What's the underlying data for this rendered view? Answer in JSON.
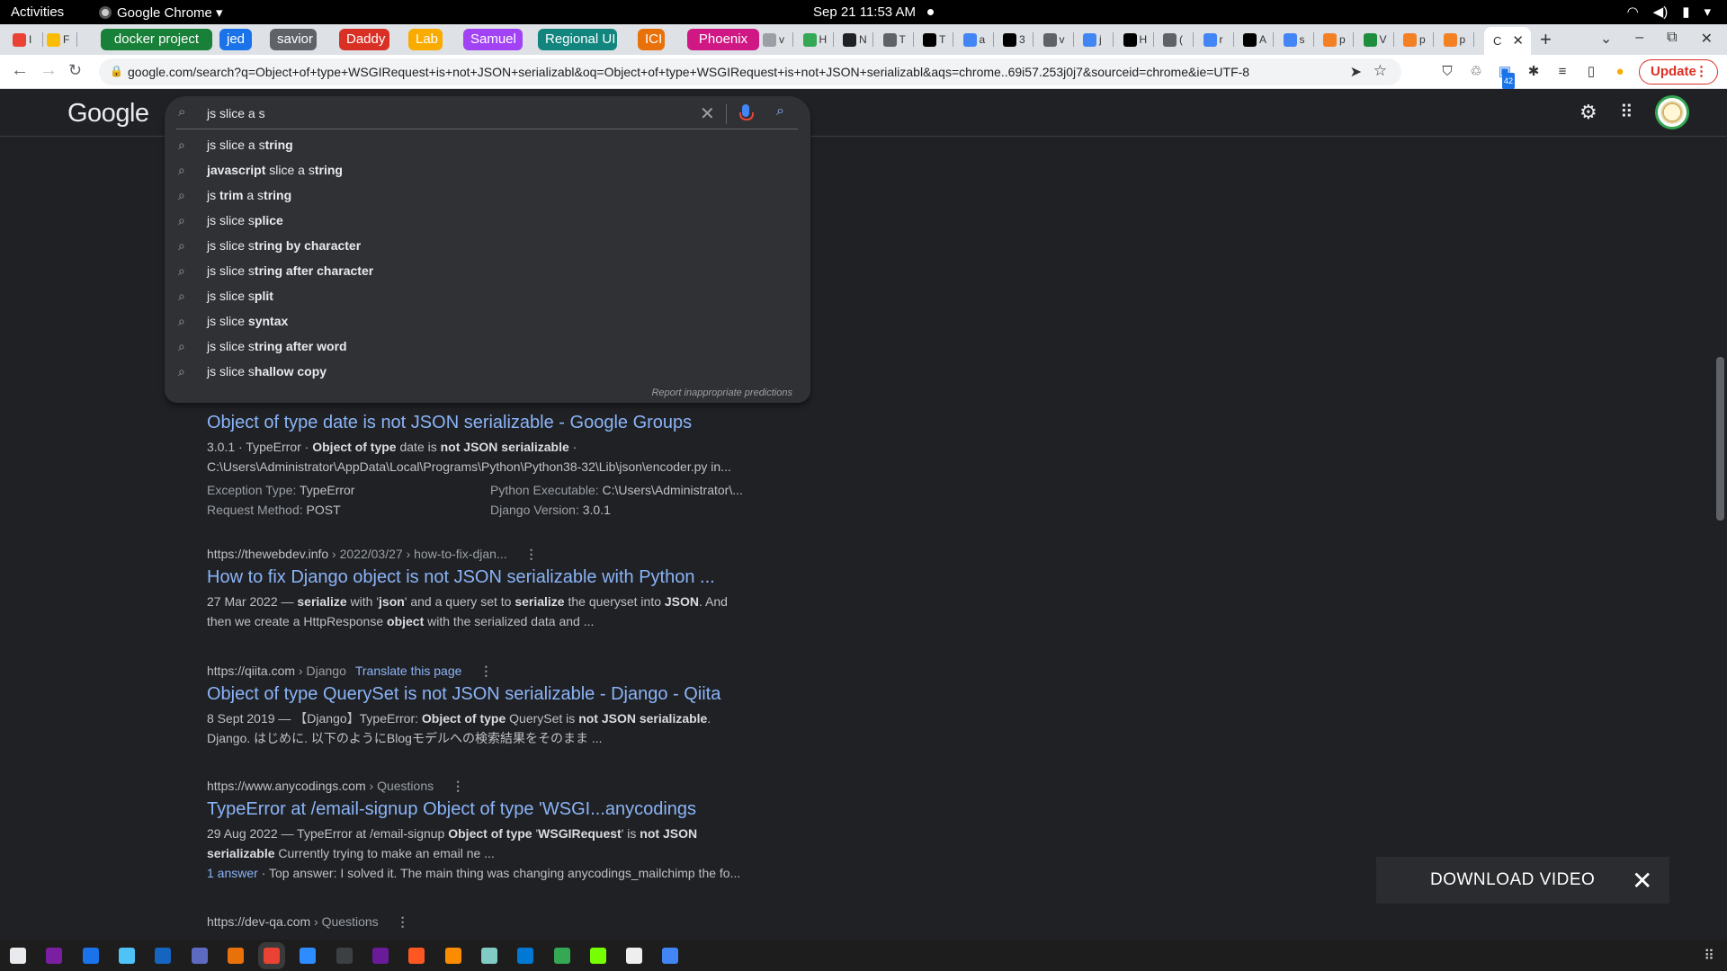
{
  "topbar": {
    "activities": "Activities",
    "app_name": "Google Chrome ▾",
    "clock": "Sep 21  11:53 AM"
  },
  "tabs": {
    "group_tabs": [
      {
        "label": "docker project",
        "color": "#188038"
      },
      {
        "label": "jed",
        "color": "#1a73e8"
      },
      {
        "label": "savior",
        "color": "#5f6368"
      },
      {
        "label": "Daddy",
        "color": "#d93025"
      },
      {
        "label": "Lab",
        "color": "#f9ab00"
      },
      {
        "label": "Samuel",
        "color": "#a142f4"
      },
      {
        "label": "Regional UI",
        "color": "#12857e"
      },
      {
        "label": "ICI",
        "color": "#e8710a"
      },
      {
        "label": "Phoenix",
        "color": "#d01884"
      }
    ],
    "pinned_left": [
      {
        "letter": "I",
        "icon": "gmail-icon",
        "color": "#ea4335"
      },
      {
        "letter": "F",
        "icon": "drive-icon",
        "color": "#fbbc04"
      }
    ],
    "small_tabs": [
      {
        "letter": "v",
        "icon": "google-icon",
        "color": "#9aa0a6"
      },
      {
        "letter": "H",
        "icon": "extension-icon",
        "color": "#34a853"
      },
      {
        "letter": "N",
        "icon": "code-icon",
        "color": "#202124"
      },
      {
        "letter": "T",
        "icon": "globe-icon",
        "color": "#5f6368"
      },
      {
        "letter": "T",
        "icon": "medium-icon",
        "color": "#000000"
      },
      {
        "letter": "a",
        "icon": "google-icon",
        "color": "#4285f4"
      },
      {
        "letter": "3",
        "icon": "medium-icon",
        "color": "#000000"
      },
      {
        "letter": "v",
        "icon": "globe-icon",
        "color": "#5f6368"
      },
      {
        "letter": "j",
        "icon": "google-icon",
        "color": "#4285f4"
      },
      {
        "letter": "H",
        "icon": "m-icon",
        "color": "#000000"
      },
      {
        "letter": "(",
        "icon": "audio-icon",
        "color": "#5f6368"
      },
      {
        "letter": "r",
        "icon": "google-icon",
        "color": "#4285f4"
      },
      {
        "letter": "A",
        "icon": "github-icon",
        "color": "#000000"
      },
      {
        "letter": "s",
        "icon": "google-icon",
        "color": "#4285f4"
      },
      {
        "letter": "p",
        "icon": "stackoverflow-icon",
        "color": "#f48024"
      },
      {
        "letter": "V",
        "icon": "app-icon",
        "color": "#1e8e3e"
      },
      {
        "letter": "p",
        "icon": "stackoverflow-icon",
        "color": "#f48024"
      },
      {
        "letter": "p",
        "icon": "stackoverflow-icon",
        "color": "#f48024"
      }
    ],
    "active_tab": {
      "letter": "C"
    }
  },
  "toolbar": {
    "url": "google.com/search?q=Object+of+type+WSGIRequest+is+not+JSON+serializabl&oq=Object+of+type+WSGIRequest+is+not+JSON+serializabl&aqs=chrome..69i57.253j0j7&sourceid=chrome&ie=UTF-8",
    "update_label": "Update",
    "badge": "42"
  },
  "google": {
    "logo": "Google",
    "query": "js slice a s",
    "suggestions": [
      {
        "plain": "js slice a s",
        "bold": "tring"
      },
      {
        "bold_pre": "javascript",
        "plain": " slice a s",
        "bold": "tring"
      },
      {
        "plain": "js ",
        "bold_mid": "trim",
        "plain2": " a s",
        "bold": "tring"
      },
      {
        "plain": "js slice s",
        "bold": "plice"
      },
      {
        "plain": "js slice s",
        "bold": "tring by character"
      },
      {
        "plain": "js slice s",
        "bold": "tring after character"
      },
      {
        "plain": "js slice s",
        "bold": "plit"
      },
      {
        "plain": "js slice ",
        "bold": "syntax"
      },
      {
        "plain": "js slice s",
        "bold": "tring after word"
      },
      {
        "plain": "js slice s",
        "bold": "hallow copy"
      }
    ],
    "report": "Report inappropriate predictions"
  },
  "results": [
    {
      "title": "Object of type date is not JSON serializable - Google Groups",
      "snippet_html": "3.0.1 · TypeError · <b>Object of type</b> date is <b>not JSON serializable</b> ·<br>C:\\Users\\Administrator\\AppData\\Local\\Programs\\Python\\Python38-32\\Lib\\json\\encoder.py in...",
      "rich": [
        [
          "Exception Type:",
          "TypeError",
          "Python Executable:",
          "C:\\Users\\Administrator\\..."
        ],
        [
          "Request Method:",
          "POST",
          "Django Version:",
          "3.0.1"
        ]
      ]
    },
    {
      "cite": "https://thewebdev.info",
      "path": " › 2022/03/27 › how-to-fix-djan...",
      "title": "How to fix Django object is not JSON serializable with Python ...",
      "snippet_html": "27 Mar 2022 — <b>serialize</b> with '<b>json</b>' and a query set to <b>serialize</b> the queryset into <b>JSON</b>. And<br>then we create a HttpResponse <b>object</b> with the serialized data and ..."
    },
    {
      "cite": "https://qiita.com",
      "path": " › Django",
      "translate": "Translate this page",
      "title": "Object of type QuerySet is not JSON serializable - Django - Qiita",
      "snippet_html": "8 Sept 2019 — 【Django】TypeError: <b>Object of type</b> QuerySet is <b>not JSON serializable</b>.<br>Django. はじめに. 以下のようにBlogモデルへの検索結果をそのまま ..."
    },
    {
      "cite": "https://www.anycodings.com",
      "path": " › Questions",
      "title": "TypeError at /email-signup Object of type 'WSGI...anycodings",
      "snippet_html": "29 Aug 2022 — TypeError at /email-signup <b>Object of type</b> '<b>WSGIRequest</b>' is <b>not JSON</b><br><b>serializable</b> Currently trying to make an email ne ...",
      "extra_link": "1 answer",
      "extra_text": " · Top answer: I solved it. The main thing was changing anycodings_mailchimp the fo..."
    },
    {
      "cite": "https://dev-qa.com",
      "path": " › Questions"
    }
  ],
  "download_video": "DOWNLOAD VIDEO"
}
